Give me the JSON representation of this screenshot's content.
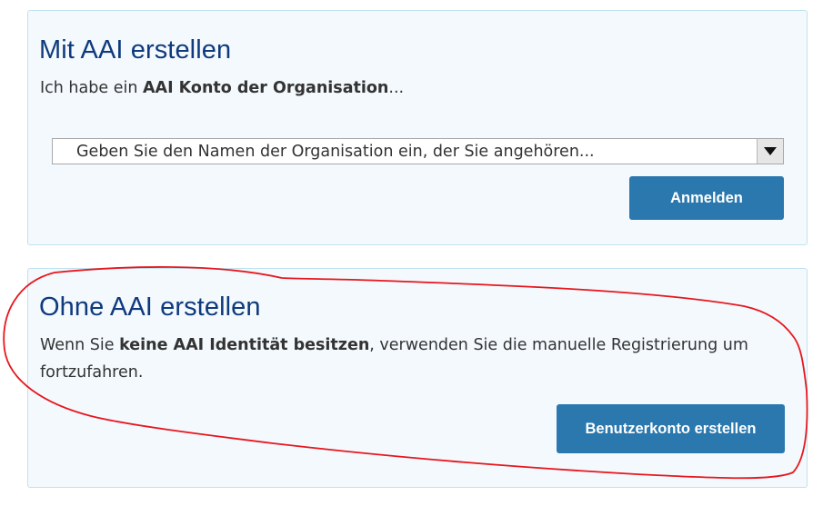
{
  "aai_section": {
    "title": "Mit AAI erstellen",
    "desc_prefix": "Ich habe ein ",
    "desc_bold": "AAI Konto der Organisation",
    "desc_suffix": "...",
    "select_placeholder": "Geben Sie den Namen der Organisation ein, der Sie angehören...",
    "login_button": "Anmelden"
  },
  "no_aai_section": {
    "title": "Ohne AAI erstellen",
    "desc_prefix": "Wenn Sie ",
    "desc_bold": "keine AAI Identität besitzen",
    "desc_suffix": ", verwenden Sie die manuelle Registrierung um fortzufahren.",
    "create_button": "Benutzerkonto erstellen"
  },
  "colors": {
    "panel_bg": "#f3f9fd",
    "panel_border": "#bfe3ef",
    "title": "#0f3a7d",
    "button": "#2a78ae",
    "annotation": "#e8161d"
  },
  "icons": {
    "dropdown": "triangle-down-icon"
  }
}
